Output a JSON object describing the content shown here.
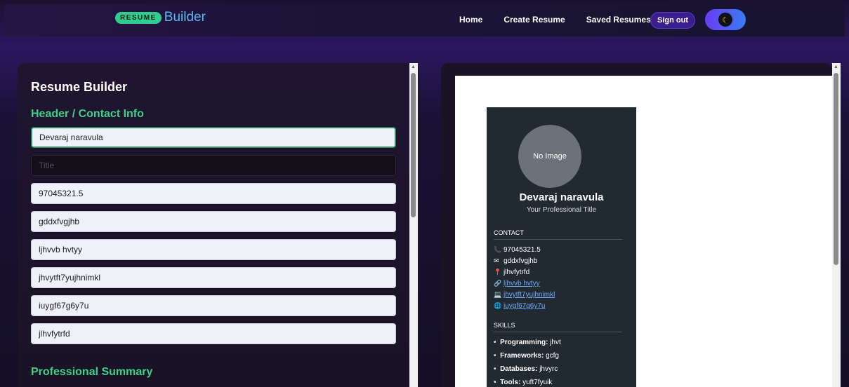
{
  "nav": {
    "brand_badge": "RESUME",
    "brand_text": "Builder",
    "links": [
      "Home",
      "Create Resume",
      "Saved Resumes"
    ],
    "signout_label": "Sign out"
  },
  "form": {
    "panel_title": "Resume Builder",
    "header_section": "Header / Contact Info",
    "name_value": "Devaraj naravula",
    "title_placeholder": "Title",
    "phone_value": "97045321.5",
    "email_value": "gddxfvgjhb",
    "linkedin_value": "ljhvvb hvtyy",
    "github_value": "jhvytft7yujhnimkl",
    "website_value": "iuygf67g6y7u",
    "location_value": "jlhvfytrfd",
    "summary_section": "Professional Summary"
  },
  "preview": {
    "no_image": "No Image",
    "name": "Devaraj naravula",
    "title": "Your Professional Title",
    "contact_heading": "CONTACT",
    "phone": "97045321.5",
    "email": "gddxfvgjhb",
    "location": "jlhvfytrfd",
    "linkedin": "ljhvvb hvtyy",
    "github": "jhvytft7yujhnimkl",
    "website": "iuygf67g6y7u",
    "skills_heading": "SKILLS",
    "skills": [
      {
        "label": "Programming:",
        "value": "jhvt"
      },
      {
        "label": "Frameworks:",
        "value": "gcfg"
      },
      {
        "label": "Databases:",
        "value": "jhvyrc"
      },
      {
        "label": "Tools:",
        "value": "yuft7fyuik"
      }
    ]
  }
}
